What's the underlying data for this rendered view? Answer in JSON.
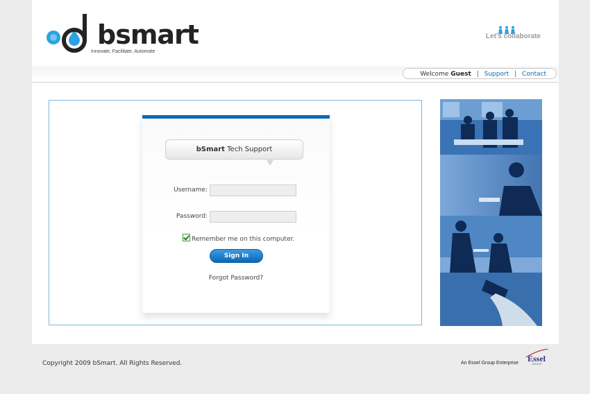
{
  "header": {
    "logo_text": "bsmart",
    "tagline": "Innovate, Facilitate, Automate",
    "collab_text": "Let's collaborate"
  },
  "nav": {
    "welcome": "Welcome",
    "user": "Guest",
    "separator": "|",
    "support": "Support",
    "contact": "Contact"
  },
  "login": {
    "title_brand": "bSmart",
    "title_rest": " Tech Support",
    "username_label": "Username:",
    "username_value": "",
    "password_label": "Password:",
    "password_value": "",
    "remember_label": "Remember me on this computer.",
    "remember_checked": true,
    "signin_label": "Sign In",
    "forgot_label": "Forgot Password?"
  },
  "footer": {
    "copyright": "Copyright 2009 bSmart. All Rights Reserved.",
    "essel_text": "An Essel Group Enterprise",
    "essel_logo": "Essel",
    "essel_logo_sub": "GROUP"
  },
  "colors": {
    "accent_blue": "#0c6ab8",
    "logo_blue": "#2ba3e0",
    "panel_border": "#7fb7df",
    "page_bg": "#ececec"
  },
  "icons": {
    "logo": "bsmart-drop-logo",
    "collab": "people-group-icon",
    "check": "checkbox-checked-icon"
  }
}
